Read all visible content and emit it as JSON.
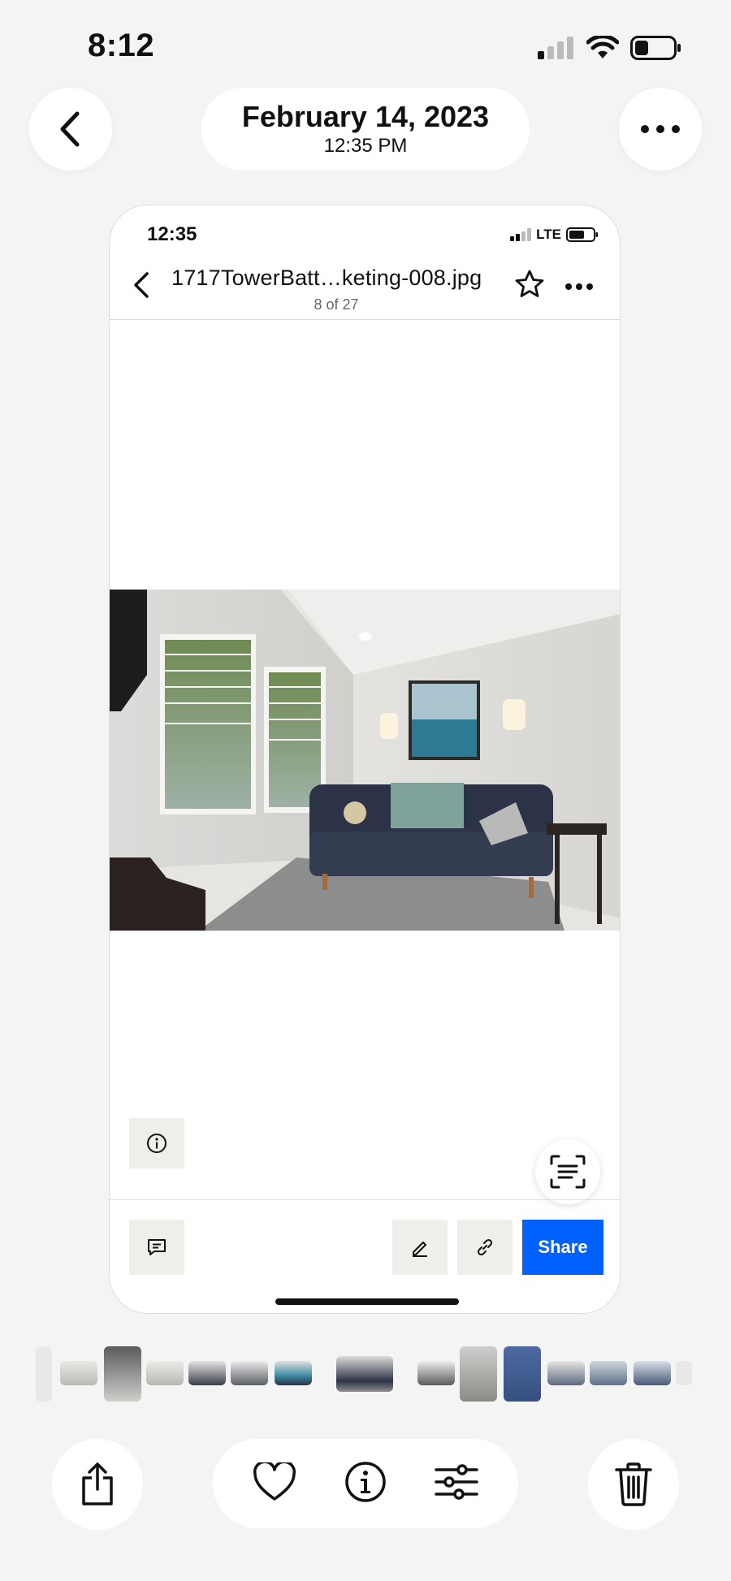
{
  "status_bar": {
    "time": "8:12"
  },
  "header": {
    "date": "February 14, 2023",
    "time": "12:35 PM"
  },
  "inner": {
    "status": {
      "time": "12:35",
      "network": "LTE"
    },
    "file_name": "1717TowerBatt…keting-008.jpg",
    "counter": "8 of 27",
    "share_label": "Share"
  },
  "icons": {
    "back": "chevron-left-icon",
    "more": "ellipsis-icon",
    "star": "star-icon",
    "info": "info-icon",
    "scan": "scan-text-icon",
    "comment": "comment-icon",
    "edit": "pencil-icon",
    "link": "link-icon",
    "share": "share-icon",
    "heart": "heart-icon",
    "adjust": "sliders-icon",
    "trash": "trash-icon"
  },
  "colors": {
    "accent": "#0061fe",
    "button_gray": "#efeeea",
    "background": "#f4f4f4"
  }
}
